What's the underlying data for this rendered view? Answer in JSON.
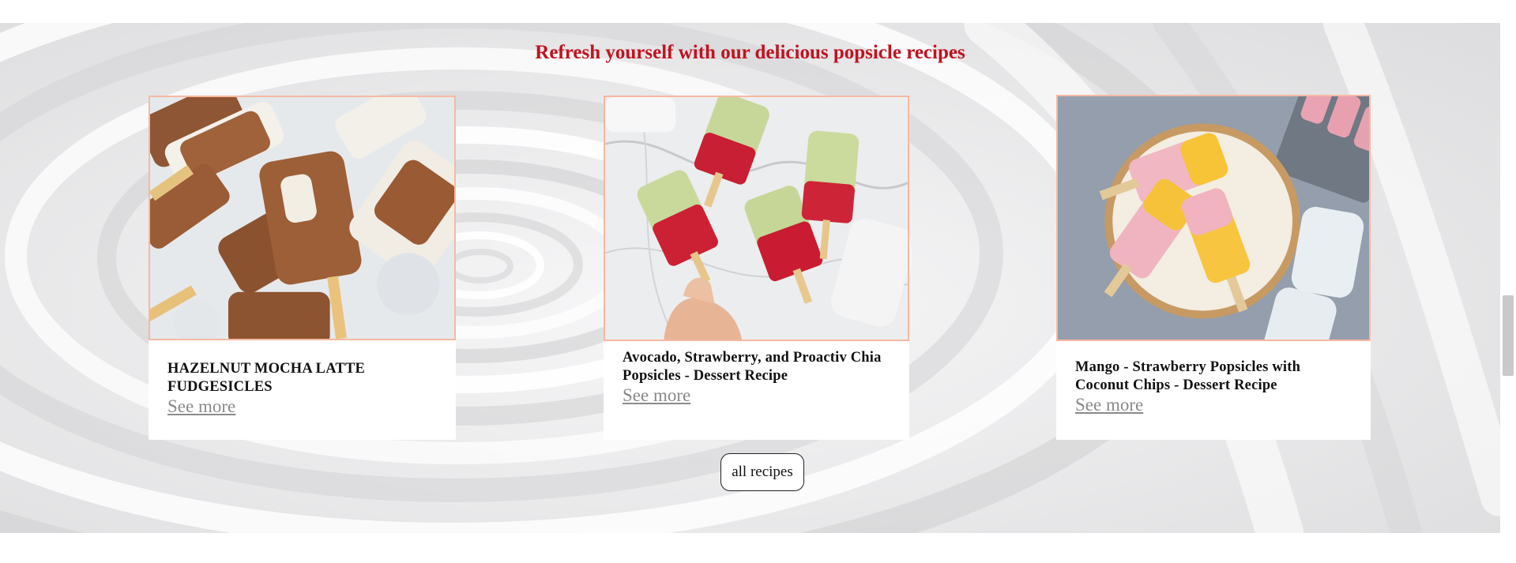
{
  "section": {
    "title": "Refresh yourself with our delicious popsicle recipes"
  },
  "cards": [
    {
      "title": "HAZELNUT MOCHA LATTE FUDGESICLES",
      "link_label": "See more",
      "image_icon": "popsicle-photo"
    },
    {
      "title": "Avocado, Strawberry, and Proactiv Chia Popsicles - Dessert Recipe",
      "link_label": "See more",
      "image_icon": "popsicle-photo"
    },
    {
      "title": "Mango - Strawberry Popsicles with Coconut Chips - Dessert Recipe",
      "link_label": "See more",
      "image_icon": "popsicle-photo"
    }
  ],
  "all_recipes_button": {
    "label": "all recipes"
  },
  "colors": {
    "title_red": "#c1121f",
    "image_border": "#f6b9a1",
    "link_gray": "#8a8a8a"
  }
}
